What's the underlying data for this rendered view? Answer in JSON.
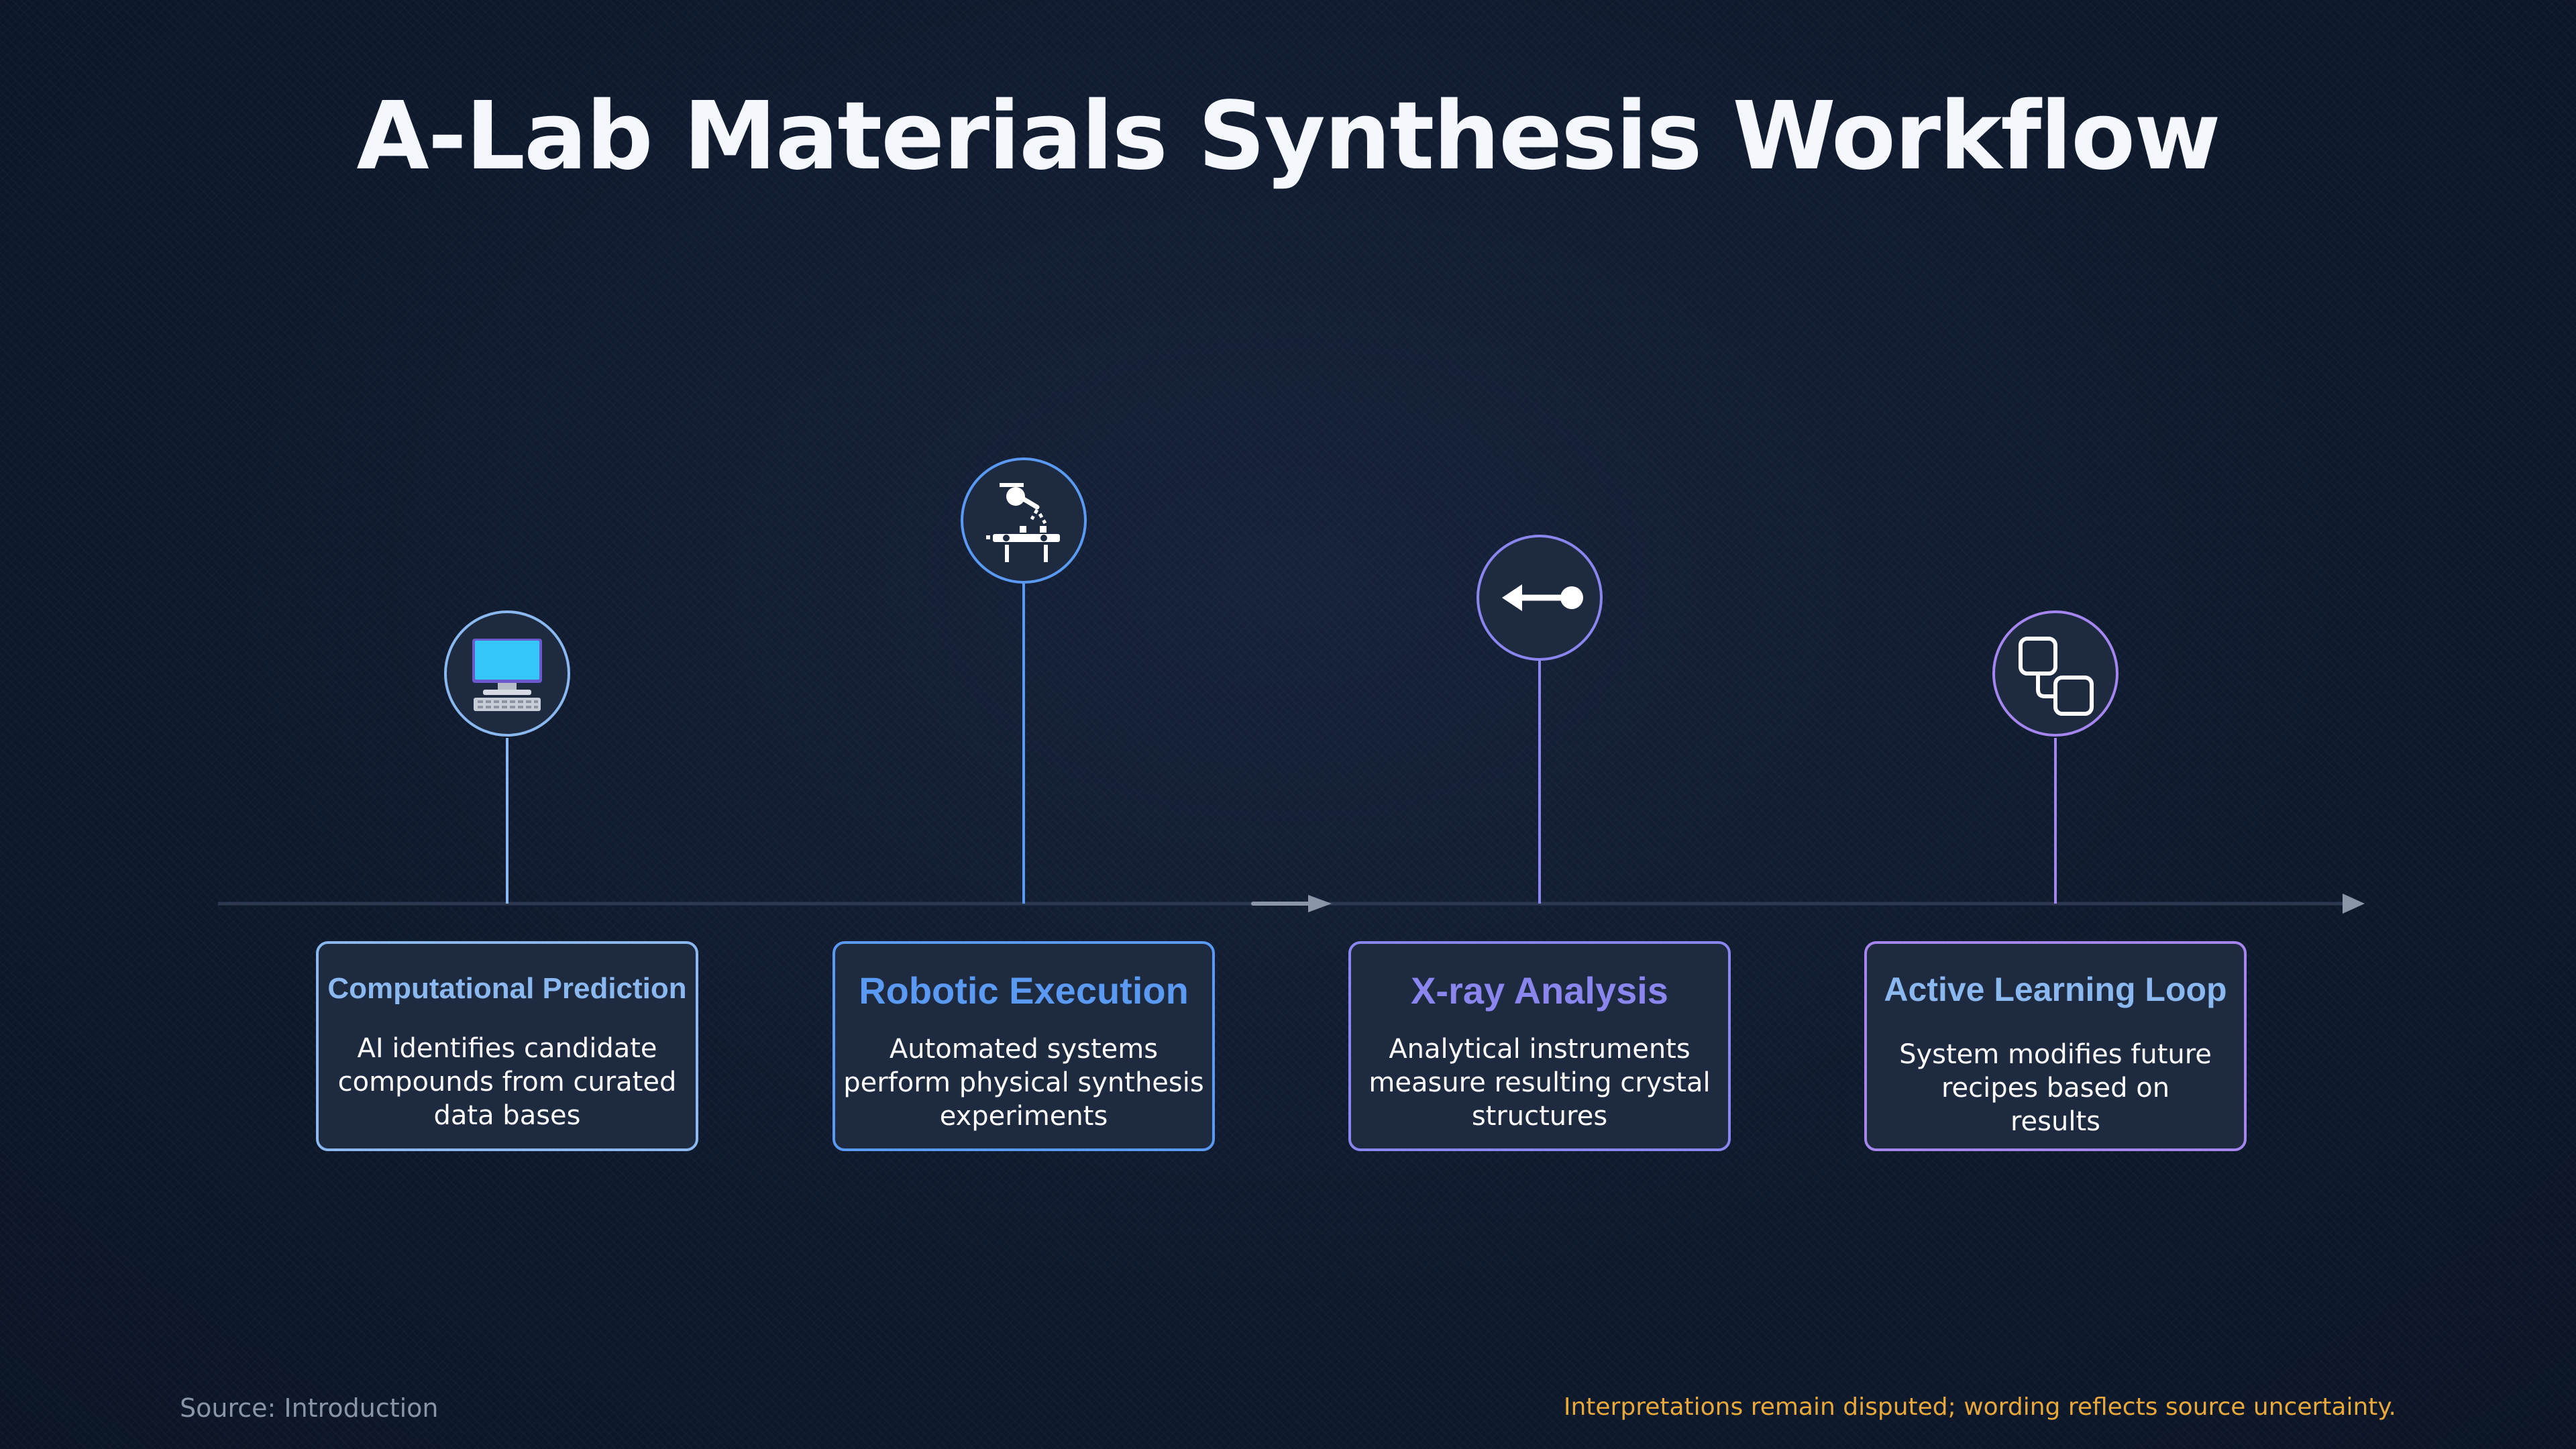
{
  "title": "A-Lab Materials Synthesis Workflow",
  "steps": [
    {
      "title": "Computational Prediction",
      "description": "AI identifies candidate compounds from curated data bases",
      "icon": "desktop-computer-icon",
      "color": "#8ab8ef"
    },
    {
      "title": "Robotic Execution",
      "description": "Automated systems perform physical synthesis experiments",
      "icon": "robot-arm-icon",
      "color": "#5b9af2"
    },
    {
      "title": "X-ray Analysis",
      "description": "Analytical instruments measure resulting crystal structures",
      "icon": "beam-arrow-icon",
      "color": "#8b86ee"
    },
    {
      "title": "Active Learning Loop",
      "description": "System modifies future recipes based on results",
      "icon": "loop-blocks-icon",
      "color": "#a586ee"
    }
  ],
  "footer": {
    "source": "Source: Introduction",
    "note": "Interpretations remain disputed; wording reflects source uncertainty."
  }
}
